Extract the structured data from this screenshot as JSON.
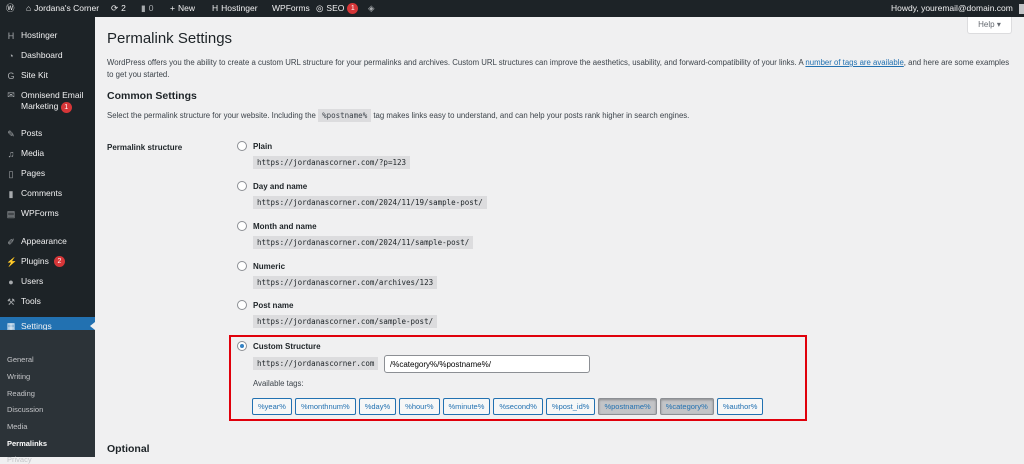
{
  "adminbar": {
    "site": "Jordana's Corner",
    "updates": "2",
    "comments": "0",
    "new": "New",
    "hostinger": "Hostinger",
    "wpforms": "WPForms",
    "seo": "SEO",
    "seo_badge": "1",
    "howdy": "Howdy, youremail@domain.com"
  },
  "sidebar": {
    "items": [
      {
        "label": "Hostinger",
        "icon": "hostinger-icon"
      },
      {
        "label": "Dashboard",
        "icon": "dashboard-icon"
      },
      {
        "label": "Site Kit",
        "icon": "google-icon"
      },
      {
        "label": "Omnisend Email",
        "label2": "Marketing",
        "badge": "1",
        "icon": "mail-icon"
      },
      {
        "label": "Posts",
        "icon": "pin-icon"
      },
      {
        "label": "Media",
        "icon": "media-icon"
      },
      {
        "label": "Pages",
        "icon": "pages-icon"
      },
      {
        "label": "Comments",
        "icon": "comment-icon"
      },
      {
        "label": "WPForms",
        "icon": "form-icon"
      },
      {
        "label": "Appearance",
        "icon": "brush-icon"
      },
      {
        "label": "Plugins",
        "badge": "2",
        "icon": "plugin-icon"
      },
      {
        "label": "Users",
        "icon": "user-icon"
      },
      {
        "label": "Tools",
        "icon": "wrench-icon"
      },
      {
        "label": "Settings",
        "icon": "settings-icon"
      }
    ],
    "submenu": [
      "General",
      "Writing",
      "Reading",
      "Discussion",
      "Media",
      "Permalinks",
      "Privacy"
    ]
  },
  "help": "Help ▾",
  "page": {
    "title": "Permalink Settings",
    "intro_pre": "WordPress offers you the ability to create a custom URL structure for your permalinks and archives. Custom URL structures can improve the aesthetics, usability, and forward-compatibility of your links. A ",
    "intro_link": "number of tags are available",
    "intro_post": ", and here are some examples to get you started.",
    "common": "Common Settings",
    "select_pre": "Select the permalink structure for your website. Including the ",
    "select_code": "%postname%",
    "select_post": " tag makes links easy to understand, and can help your posts rank higher in search engines.",
    "structure_label": "Permalink structure",
    "options": [
      {
        "label": "Plain",
        "url": "https://jordanascorner.com/?p=123"
      },
      {
        "label": "Day and name",
        "url": "https://jordanascorner.com/2024/11/19/sample-post/"
      },
      {
        "label": "Month and name",
        "url": "https://jordanascorner.com/2024/11/sample-post/"
      },
      {
        "label": "Numeric",
        "url": "https://jordanascorner.com/archives/123"
      },
      {
        "label": "Post name",
        "url": "https://jordanascorner.com/sample-post/"
      }
    ],
    "custom": {
      "label": "Custom Structure",
      "prefix": "https://jordanascorner.com",
      "value": "/%category%/%postname%/",
      "available": "Available tags:",
      "tags": [
        "%year%",
        "%monthnum%",
        "%day%",
        "%hour%",
        "%minute%",
        "%second%",
        "%post_id%",
        "%postname%",
        "%category%",
        "%author%"
      ],
      "active_tags": [
        "%postname%",
        "%category%"
      ]
    },
    "optional": "Optional"
  },
  "colors": {
    "accent": "#2271b1",
    "highlight": "#e0000b",
    "sidebar": "#1d2327"
  }
}
